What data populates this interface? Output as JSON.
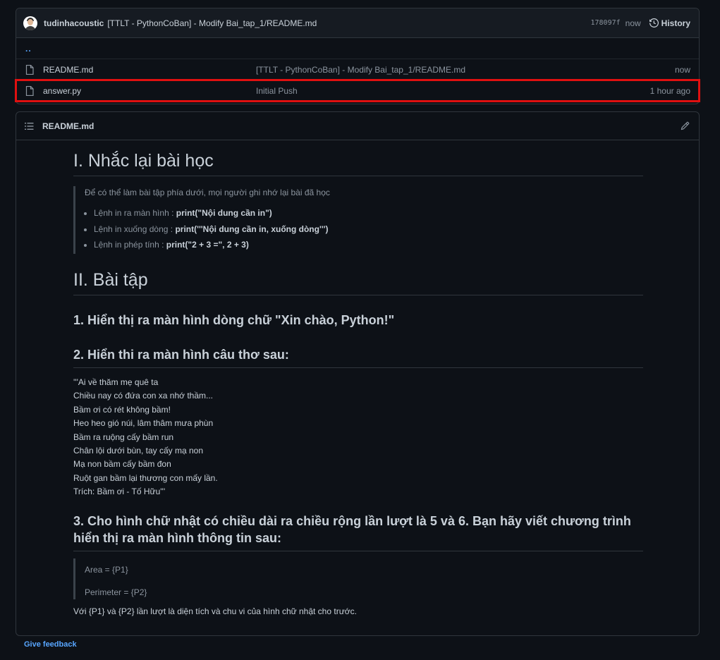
{
  "commit": {
    "author": "tudinhacoustic",
    "message": "[TTLT - PythonCoBan] - Modify Bai_tap_1/README.md",
    "sha": "178097f",
    "time": "now",
    "history_label": "History",
    "icons": [
      "avatar",
      "history-icon"
    ]
  },
  "files": {
    "parent_label": "..",
    "rows": [
      {
        "name": "README.md",
        "message": "[TTLT - PythonCoBan] - Modify Bai_tap_1/README.md",
        "time": "now"
      },
      {
        "name": "answer.py",
        "message": "Initial Push",
        "time": "1 hour ago"
      }
    ]
  },
  "readme": {
    "header_title": "README.md",
    "h1_review": "I. Nhắc lại bài học",
    "intro": "Để có thể làm bài tập phía dưới, mọi người ghi nhớ lại bài đã học",
    "items": [
      {
        "prefix": "Lệnh in ra màn hình : ",
        "code": "print(\"Nội dung cần in\")"
      },
      {
        "prefix": "Lệnh in xuống dòng : ",
        "code": "print('''Nội dung cần in, xuống dòng''')"
      },
      {
        "prefix": "Lệnh in phép tính : ",
        "code": "print(\"2 + 3 =\", 2 + 3)"
      }
    ],
    "h1_exercises": "II. Bài tập",
    "ex1": "1. Hiển thị ra màn hình dòng chữ \"Xin chào, Python!\"",
    "ex2": "2. Hiển thi ra màn hình câu thơ sau:",
    "poem": [
      "'''Ai về thăm mẹ quê ta",
      "Chiều nay có đứa con xa nhớ thầm...",
      "Bầm ơi có rét không bầm!",
      "Heo heo gió núi, lâm thâm mưa phùn",
      "Bầm ra ruộng cấy bầm run",
      "Chân lội dưới bùn, tay cấy mạ non",
      "Mạ non bầm cấy bầm đon",
      "Ruột gan bầm lại thương con mấy lần.",
      "Trích: Bầm ơi - Tố Hữu'''"
    ],
    "ex3_line1": "3. Cho hình chữ nhật có chiều dài ra chiều rộng lần lượt là 5 và 6. Bạn hãy viết chương trình",
    "ex3_line2": "hiển thị ra màn hình thông tin sau:",
    "area": "Area = {P1}",
    "perimeter": "Perimeter = {P2}",
    "note": "Với {P1} và {P2} lần lượt là diện tích và chu vi của hình chữ nhật cho trước."
  },
  "footer": {
    "feedback": "Give feedback"
  },
  "colors": {
    "background": "#0d1117",
    "link": "#58a6ff",
    "highlight": "#e01010"
  }
}
